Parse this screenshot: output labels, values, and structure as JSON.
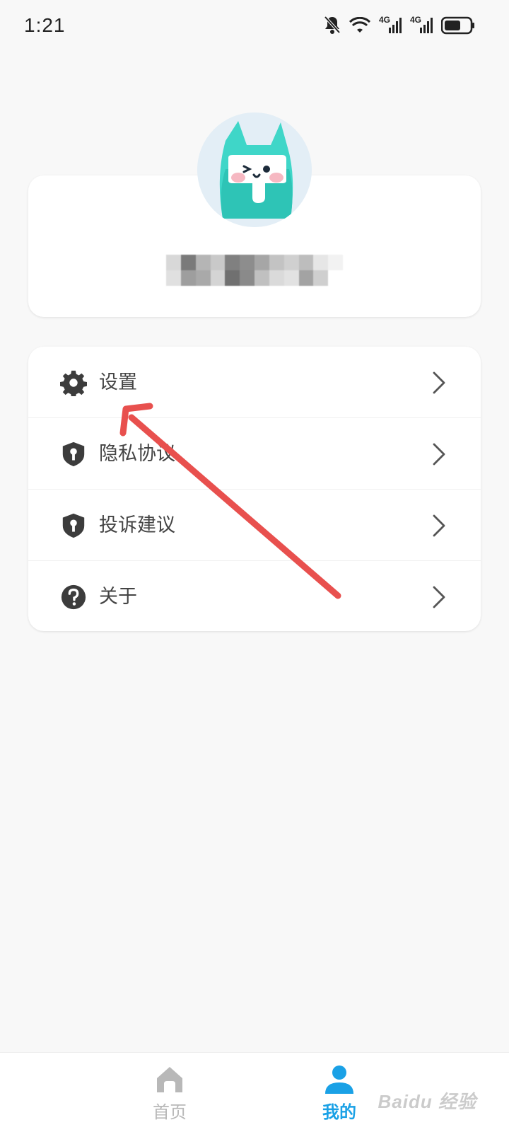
{
  "status_bar": {
    "time": "1:21",
    "network_label_1": "4G",
    "network_label_2": "4G"
  },
  "profile": {
    "username": ""
  },
  "menu": {
    "items": [
      {
        "label": "设置",
        "icon": "gear-icon"
      },
      {
        "label": "隐私协议",
        "icon": "shield-key-icon"
      },
      {
        "label": "投诉建议",
        "icon": "shield-key-icon"
      },
      {
        "label": "关于",
        "icon": "question-circle-icon"
      }
    ]
  },
  "bottom_nav": {
    "items": [
      {
        "label": "首页",
        "icon": "home-icon",
        "active": false
      },
      {
        "label": "我的",
        "icon": "person-icon",
        "active": true
      }
    ]
  },
  "watermark": "Baidu 经验",
  "colors": {
    "accent": "#1aa1e6",
    "annotation": "#e8504e",
    "avatar_teal": "#3fd6c8"
  }
}
